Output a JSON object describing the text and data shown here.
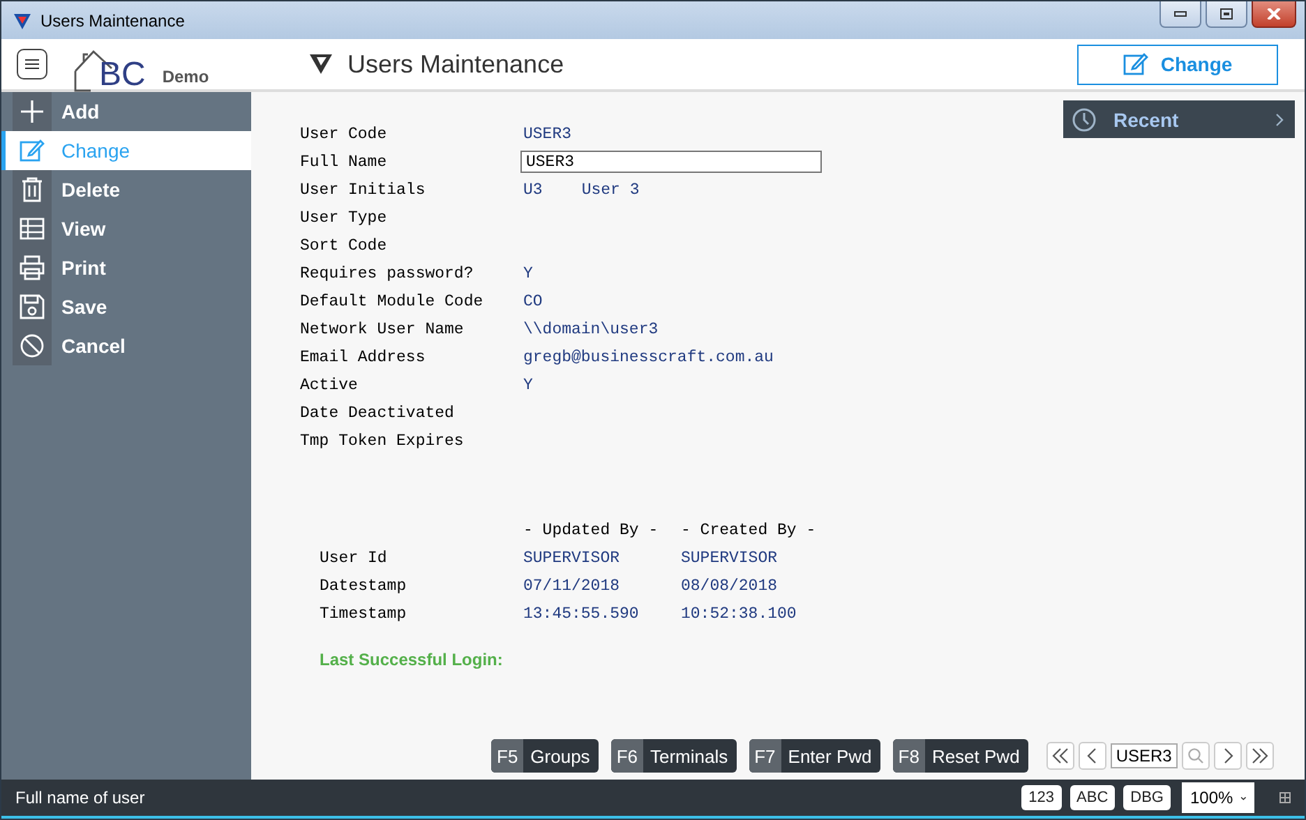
{
  "window": {
    "title": "Users Maintenance"
  },
  "header": {
    "logo_text": "BC",
    "logo_caption": "Demo",
    "page_title": "Users Maintenance",
    "action_button": "Change"
  },
  "sidebar": {
    "items": [
      {
        "label": "Add",
        "selected": false
      },
      {
        "label": "Change",
        "selected": true
      },
      {
        "label": "Delete",
        "selected": false
      },
      {
        "label": "View",
        "selected": false
      },
      {
        "label": "Print",
        "selected": false
      },
      {
        "label": "Save",
        "selected": false
      },
      {
        "label": "Cancel",
        "selected": false
      }
    ]
  },
  "recent": {
    "label": "Recent"
  },
  "form": {
    "fields": [
      {
        "label": "User Code",
        "kind": "text",
        "values": [
          "USER3"
        ]
      },
      {
        "label": "Full Name",
        "kind": "input",
        "values": [
          "USER3"
        ]
      },
      {
        "label": "User Initials",
        "kind": "text",
        "values": [
          "U3",
          "User 3"
        ]
      },
      {
        "label": "User Type",
        "kind": "text"
      },
      {
        "label": "Sort Code",
        "kind": "text"
      },
      {
        "label": "Requires password?",
        "kind": "text",
        "values": [
          "Y"
        ]
      },
      {
        "label": "Default Module Code",
        "kind": "text",
        "values": [
          "CO"
        ]
      },
      {
        "label": "Network User Name",
        "kind": "text",
        "values": [
          "\\\\domain\\user3"
        ]
      },
      {
        "label": "Email Address",
        "kind": "text",
        "values": [
          "gregb@businesscraft.com.au"
        ]
      },
      {
        "label": "Active",
        "kind": "text",
        "values": [
          "Y"
        ]
      },
      {
        "label": "Date Deactivated",
        "kind": "text"
      },
      {
        "label": "Tmp Token Expires",
        "kind": "text"
      }
    ]
  },
  "audit": {
    "columns": [
      "- Updated By -",
      "- Created By -"
    ],
    "rows": [
      {
        "label": "User Id",
        "values": [
          "SUPERVISOR",
          "SUPERVISOR"
        ]
      },
      {
        "label": "Datestamp",
        "values": [
          "07/11/2018",
          "08/08/2018"
        ]
      },
      {
        "label": "Timestamp",
        "values": [
          "13:45:55.590",
          "10:52:38.100"
        ]
      }
    ]
  },
  "last_login": {
    "label": "Last Successful Login:"
  },
  "function_keys": [
    {
      "key": "F5",
      "label": "Groups"
    },
    {
      "key": "F6",
      "label": "Terminals"
    },
    {
      "key": "F7",
      "label": "Enter Pwd"
    },
    {
      "key": "F8",
      "label": "Reset Pwd"
    }
  ],
  "navigator": {
    "value": "USER3"
  },
  "status_bar": {
    "message": "Full name of user",
    "badges": [
      "123",
      "ABC",
      "DBG"
    ],
    "zoom": "100%"
  }
}
